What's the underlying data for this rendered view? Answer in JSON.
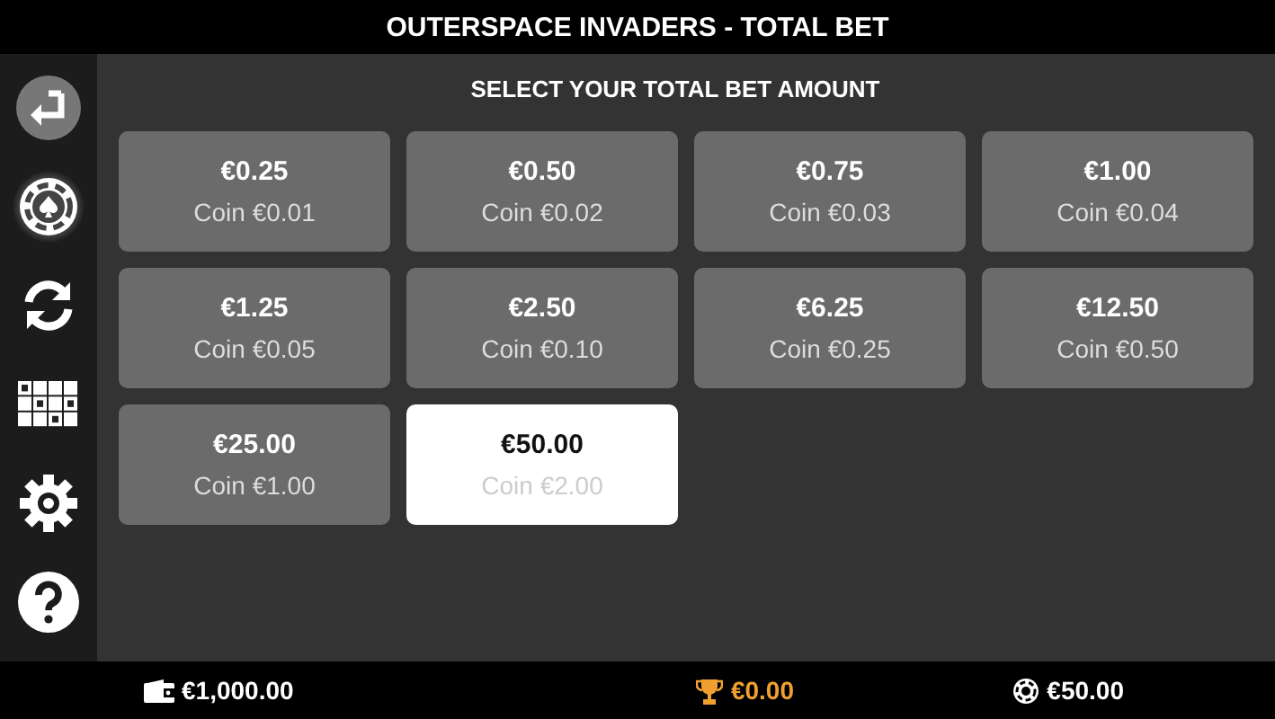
{
  "window": {
    "title": "OUTERSPACE INVADERS - TOTAL BET"
  },
  "sidebar": {
    "items": [
      {
        "kind": "back",
        "selected": false
      },
      {
        "kind": "chip",
        "selected": true
      },
      {
        "kind": "refresh",
        "selected": false
      },
      {
        "kind": "grid",
        "selected": false
      },
      {
        "kind": "settings",
        "selected": false
      },
      {
        "kind": "help",
        "selected": false
      }
    ]
  },
  "heading": "SELECT YOUR TOTAL BET AMOUNT",
  "bets": [
    {
      "amount": "€0.25",
      "coin": "Coin €0.01",
      "selected": false
    },
    {
      "amount": "€0.50",
      "coin": "Coin €0.02",
      "selected": false
    },
    {
      "amount": "€0.75",
      "coin": "Coin €0.03",
      "selected": false
    },
    {
      "amount": "€1.00",
      "coin": "Coin €0.04",
      "selected": false
    },
    {
      "amount": "€1.25",
      "coin": "Coin €0.05",
      "selected": false
    },
    {
      "amount": "€2.50",
      "coin": "Coin €0.10",
      "selected": false
    },
    {
      "amount": "€6.25",
      "coin": "Coin €0.25",
      "selected": false
    },
    {
      "amount": "€12.50",
      "coin": "Coin €0.50",
      "selected": false
    },
    {
      "amount": "€25.00",
      "coin": "Coin €1.00",
      "selected": false
    },
    {
      "amount": "€50.00",
      "coin": "Coin €2.00",
      "selected": true
    }
  ],
  "status_bar": [
    {
      "kind": "wallet",
      "value": "€1,000.00",
      "color": "#ffffff"
    },
    {
      "kind": "trophy",
      "value": "€0.00",
      "color": "#f0a030"
    },
    {
      "kind": "chip",
      "value": "€50.00",
      "color": "#ffffff"
    }
  ]
}
